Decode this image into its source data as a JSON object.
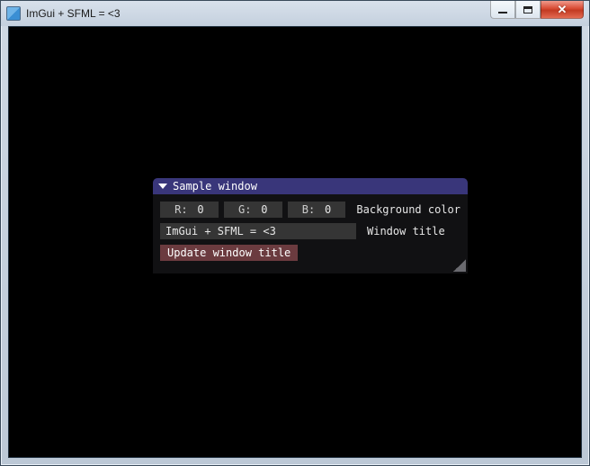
{
  "os_window": {
    "title": "ImGui + SFML = <3",
    "controls": {
      "minimize": "minimize",
      "maximize": "maximize",
      "close": "close"
    }
  },
  "imgui": {
    "title": "Sample window",
    "bg_color": {
      "r_label": "R:",
      "r_value": "0",
      "g_label": "G:",
      "g_value": "0",
      "b_label": "B:",
      "b_value": "0",
      "caption": "Background color"
    },
    "title_input": {
      "value": "ImGui + SFML = <3",
      "caption": "Window title"
    },
    "button": {
      "label": "Update window title"
    }
  },
  "colors": {
    "imgui_title_bg": "#39367a",
    "imgui_body_bg": "#121214",
    "input_bg": "#353535",
    "button_bg": "#6b3b3f"
  }
}
